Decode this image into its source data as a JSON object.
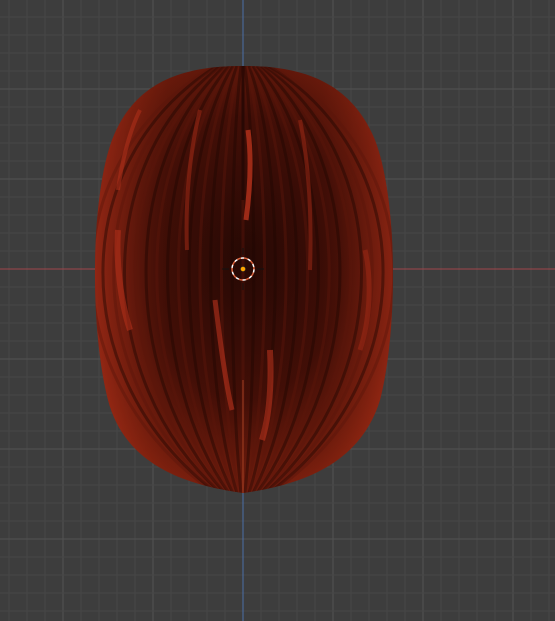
{
  "viewport": {
    "background_color": "#3d3d3d",
    "grid_minor_color": "#474747",
    "grid_major_color": "#525252",
    "x_axis_color": "#a0454a",
    "y_axis_color": "#4a6ea8",
    "mesh_base_color": "#3a0c06",
    "mesh_highlight_color": "#b8321c",
    "cursor_outer_color": "#ffffff",
    "cursor_inner_color": "#d9603a",
    "origin_color": "#ffa500"
  },
  "object": {
    "name_icon": "mesh-object",
    "cursor_icon": "3d-cursor-icon",
    "origin_icon": "object-origin-icon"
  }
}
